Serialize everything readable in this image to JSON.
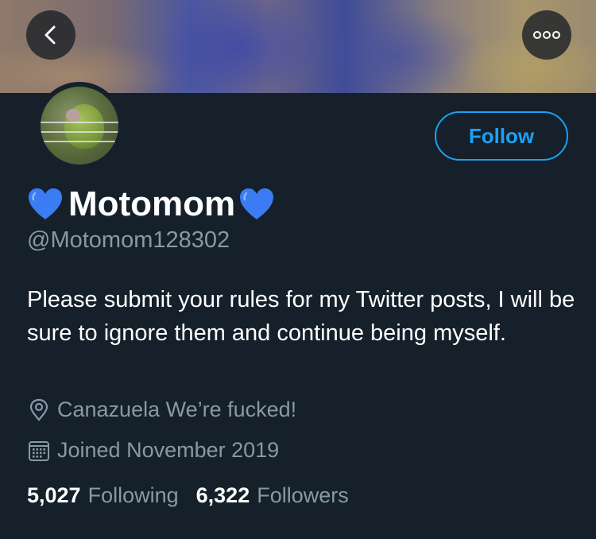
{
  "header": {
    "back_icon": "chevron-left-icon",
    "more_icon": "more-horizontal-icon"
  },
  "profile": {
    "display_name": "Motomom",
    "name_prefix_emoji": "blue-heart-icon",
    "name_suffix_emoji": "blue-heart-icon",
    "handle": "@Motomom128302",
    "bio": "Please submit your rules for my Twitter posts, I will be sure to ignore them and continue being myself.",
    "location": "Canazuela We’re fucked!",
    "joined": "Joined November 2019",
    "avatar_icon": "parrot-avatar"
  },
  "actions": {
    "follow_label": "Follow"
  },
  "stats": {
    "following_count": "5,027",
    "following_label": "Following",
    "followers_count": "6,322",
    "followers_label": "Followers"
  },
  "colors": {
    "background": "#15202b",
    "accent": "#1da1f2",
    "secondary_text": "#8899a6",
    "heart": "#3b7cf4"
  }
}
